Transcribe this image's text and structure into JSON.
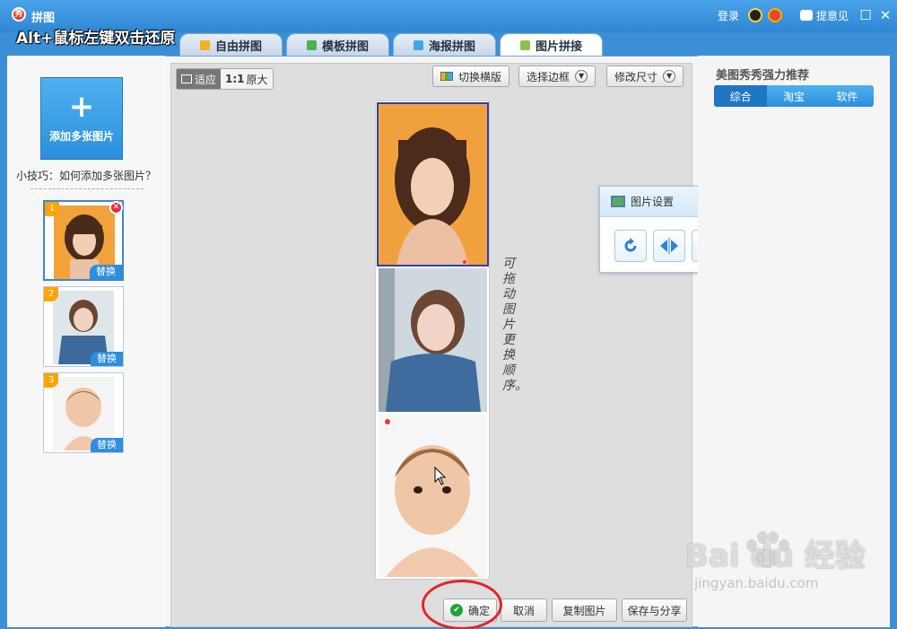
{
  "window": {
    "app_icon": "秀",
    "title": "拼图",
    "overlay_hint": "Alt+鼠标左键双击还原",
    "login_label": "登录",
    "feedback_label": "提意见",
    "maximize_glyph": "☐",
    "close_glyph": "✕"
  },
  "tabs": [
    {
      "label": "自由拼图",
      "icon_color": "#f2b31b"
    },
    {
      "label": "模板拼图",
      "icon_color": "#4caf50"
    },
    {
      "label": "海报拼图",
      "icon_color": "#3fa7e6"
    },
    {
      "label": "图片拼接",
      "icon_color": "#8bc34a",
      "active": true
    }
  ],
  "left_panel": {
    "add_symbol": "+",
    "add_label": "添加多张图片",
    "tip": "小技巧：如何添加多张图片？",
    "thumbnails": [
      {
        "number": "1",
        "replace_label": "替换",
        "selected": true,
        "delete_glyph": "✕"
      },
      {
        "number": "2",
        "replace_label": "替换"
      },
      {
        "number": "3",
        "replace_label": "替换"
      }
    ]
  },
  "toolbar": {
    "fit_label": "适应",
    "original_prefix": "1:1",
    "original_label": "原大",
    "switch_layout": "切换横版",
    "select_border": "选择边框",
    "modify_size": "修改尺寸"
  },
  "canvas": {
    "handwritten_note": "可拖动图片更换顺序。"
  },
  "image_settings": {
    "title": "图片设置",
    "close_glyph": "✕",
    "tools": [
      "rotate-icon",
      "flip-horizontal-icon",
      "copy-icon",
      "trash-icon"
    ]
  },
  "right_panel": {
    "title": "美图秀秀强力推荐",
    "tabs": [
      "综合",
      "淘宝",
      "软件"
    ]
  },
  "actions": {
    "confirm_check": "✔",
    "confirm": "确定",
    "cancel": "取消",
    "copy_image": "复制图片",
    "save_share": "保存与分享"
  },
  "watermark": {
    "brand": "Bai du 经验",
    "url": "jingyan.baidu.com"
  },
  "colors": {
    "accent": "#2c8fdd",
    "confirm_ring": "#e2242a",
    "selection": "#2a3fb0"
  }
}
